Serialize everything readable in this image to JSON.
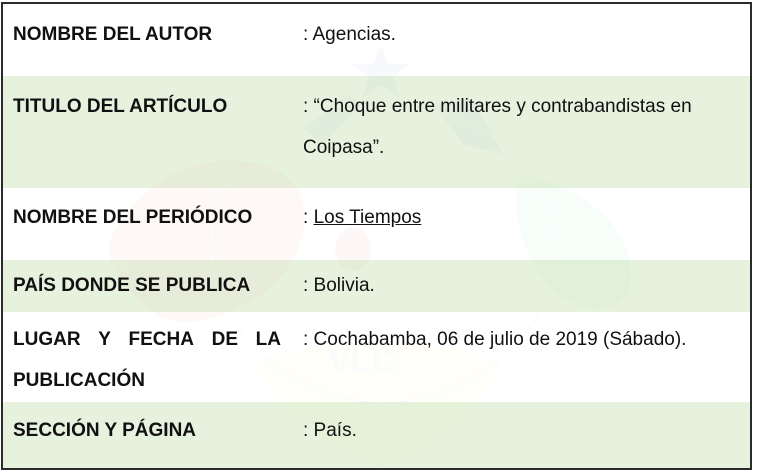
{
  "rows": [
    {
      "label": "NOMBRE DEL AUTOR",
      "value": ": Agencias."
    },
    {
      "label": "TITULO DEL ARTÍCULO",
      "value_line1": ": “Choque entre militares y contrabandistas en",
      "value_line2": "Coipasa”."
    },
    {
      "label": "NOMBRE DEL PERIÓDICO",
      "value_prefix": ": ",
      "value_link": "Los Tiempos"
    },
    {
      "label": "PAÍS DONDE SE PUBLICA",
      "value": ": Bolivia."
    },
    {
      "label_words": [
        "LUGAR",
        "Y",
        "FECHA",
        "DE",
        "LA"
      ],
      "label_line2": "PUBLICACIÓN",
      "value": ": Cochabamba, 06 de julio de 2019 (Sábado)."
    },
    {
      "label": "SECCIÓN Y PÁGINA",
      "value": ": País."
    }
  ],
  "watermark": {
    "text": "VLC",
    "colors": {
      "red": "#e74c3c",
      "green": "#2ecc71",
      "yellow": "#f1e14a",
      "blue": "#3a6fb0"
    }
  }
}
